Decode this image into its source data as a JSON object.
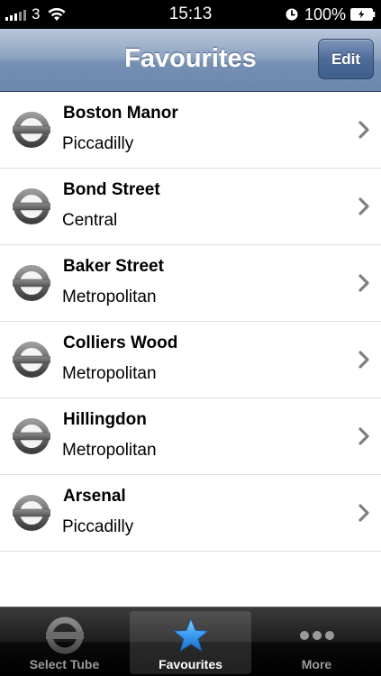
{
  "status_bar": {
    "carrier": "3",
    "time": "15:13",
    "battery_percent": "100%"
  },
  "nav": {
    "title": "Favourites",
    "edit_label": "Edit"
  },
  "favourites": [
    {
      "station": "Boston Manor",
      "line": "Piccadilly"
    },
    {
      "station": "Bond Street",
      "line": "Central"
    },
    {
      "station": "Baker Street",
      "line": "Metropolitan"
    },
    {
      "station": "Colliers Wood",
      "line": "Metropolitan"
    },
    {
      "station": "Hillingdon",
      "line": "Metropolitan"
    },
    {
      "station": "Arsenal",
      "line": "Piccadilly"
    }
  ],
  "tabs": [
    {
      "label": "Select Tube",
      "icon": "tube-roundel-icon",
      "selected": false
    },
    {
      "label": "Favourites",
      "icon": "star-icon",
      "selected": true
    },
    {
      "label": "More",
      "icon": "more-dots-icon",
      "selected": false
    }
  ],
  "colors": {
    "nav_gradient_top": "#b9c7db",
    "nav_gradient_bottom": "#6d87ad",
    "edit_button": "#4f6c98",
    "selected_tab_icon": "#3a9cf0",
    "chevron": "#7f7f7f"
  }
}
